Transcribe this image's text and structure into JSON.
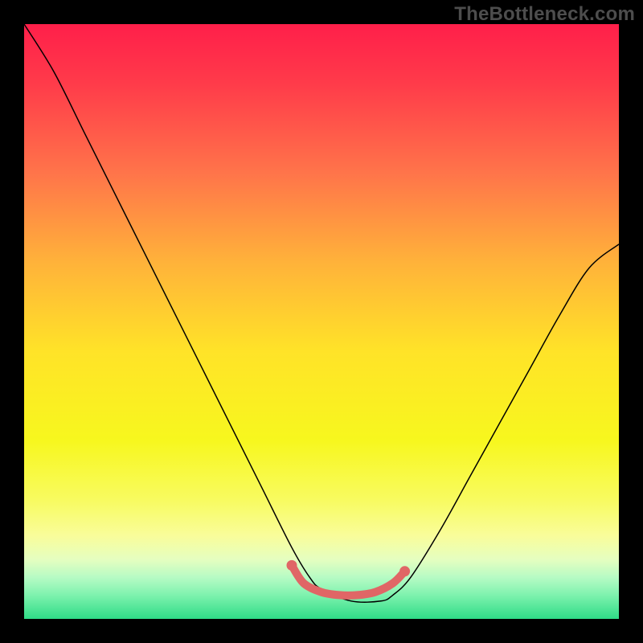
{
  "watermark": "TheBottleneck.com",
  "chart_data": {
    "type": "line",
    "title": "",
    "xlabel": "",
    "ylabel": "",
    "xlim": [
      0,
      100
    ],
    "ylim": [
      0,
      100
    ],
    "grid": false,
    "legend": false,
    "background_gradient_stops": [
      {
        "offset": 0.0,
        "color": "#ff1f4a"
      },
      {
        "offset": 0.1,
        "color": "#ff3b4a"
      },
      {
        "offset": 0.25,
        "color": "#ff744a"
      },
      {
        "offset": 0.4,
        "color": "#ffb23a"
      },
      {
        "offset": 0.55,
        "color": "#ffe328"
      },
      {
        "offset": 0.7,
        "color": "#f7f71e"
      },
      {
        "offset": 0.8,
        "color": "#f8fb60"
      },
      {
        "offset": 0.86,
        "color": "#f9fd9a"
      },
      {
        "offset": 0.9,
        "color": "#e5fec0"
      },
      {
        "offset": 0.93,
        "color": "#b7fbc4"
      },
      {
        "offset": 0.96,
        "color": "#7ef2ae"
      },
      {
        "offset": 1.0,
        "color": "#2fdc87"
      }
    ],
    "series": [
      {
        "name": "bottleneck-curve",
        "color": "#000000",
        "stroke_width": 1.5,
        "x": [
          0,
          5,
          10,
          15,
          20,
          25,
          30,
          35,
          40,
          45,
          48,
          50,
          55,
          60,
          62,
          65,
          70,
          75,
          80,
          85,
          90,
          95,
          100
        ],
        "y": [
          100,
          92,
          82,
          72,
          62,
          52,
          42,
          32,
          22,
          12,
          7,
          5,
          3,
          3,
          4,
          7,
          15,
          24,
          33,
          42,
          51,
          59,
          63
        ]
      },
      {
        "name": "flat-bottom-marker",
        "color": "#e06666",
        "stroke_width": 10,
        "marker": true,
        "x": [
          45,
          47,
          50,
          53,
          56,
          59,
          62,
          64
        ],
        "y": [
          9,
          6,
          4.5,
          4,
          4,
          4.5,
          6,
          8
        ]
      }
    ]
  }
}
